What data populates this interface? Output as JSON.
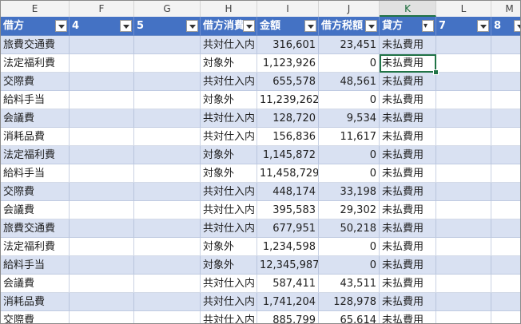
{
  "columns": [
    "E",
    "F",
    "G",
    "H",
    "I",
    "J",
    "K",
    "L",
    "M"
  ],
  "selected_column": "K",
  "table": {
    "headers": [
      "借方",
      "4",
      "5",
      "借方消費",
      "金額",
      "借方税額",
      "貸方",
      "7",
      "8"
    ],
    "rows": [
      [
        "旅費交通費",
        "",
        "",
        "共対仕入内",
        "316,601",
        "23,451",
        "未払費用",
        "",
        ""
      ],
      [
        "法定福利費",
        "",
        "",
        "対象外",
        "1,123,926",
        "0",
        "未払費用",
        "",
        ""
      ],
      [
        "交際費",
        "",
        "",
        "共対仕入内",
        "655,578",
        "48,561",
        "未払費用",
        "",
        ""
      ],
      [
        "給料手当",
        "",
        "",
        "対象外",
        "11,239,262",
        "0",
        "未払費用",
        "",
        ""
      ],
      [
        "会議費",
        "",
        "",
        "共対仕入内",
        "128,720",
        "9,534",
        "未払費用",
        "",
        ""
      ],
      [
        "消耗品費",
        "",
        "",
        "共対仕入内",
        "156,836",
        "11,617",
        "未払費用",
        "",
        ""
      ],
      [
        "法定福利費",
        "",
        "",
        "対象外",
        "1,145,872",
        "0",
        "未払費用",
        "",
        ""
      ],
      [
        "給料手当",
        "",
        "",
        "対象外",
        "11,458,729",
        "0",
        "未払費用",
        "",
        ""
      ],
      [
        "交際費",
        "",
        "",
        "共対仕入内",
        "448,174",
        "33,198",
        "未払費用",
        "",
        ""
      ],
      [
        "会議費",
        "",
        "",
        "共対仕入内",
        "395,583",
        "29,302",
        "未払費用",
        "",
        ""
      ],
      [
        "旅費交通費",
        "",
        "",
        "共対仕入内",
        "677,951",
        "50,218",
        "未払費用",
        "",
        ""
      ],
      [
        "法定福利費",
        "",
        "",
        "対象外",
        "1,234,598",
        "0",
        "未払費用",
        "",
        ""
      ],
      [
        "給料手当",
        "",
        "",
        "対象外",
        "12,345,987",
        "0",
        "未払費用",
        "",
        ""
      ],
      [
        "会議費",
        "",
        "",
        "共対仕入内",
        "587,411",
        "43,511",
        "未払費用",
        "",
        ""
      ],
      [
        "消耗品費",
        "",
        "",
        "共対仕入内",
        "1,741,204",
        "128,978",
        "未払費用",
        "",
        ""
      ],
      [
        "交際費",
        "",
        "",
        "共対仕入内",
        "885,799",
        "65,614",
        "未払費用",
        "",
        ""
      ]
    ]
  },
  "colors": {
    "header_bg": "#4472c4",
    "band_bg": "#d9e1f2",
    "selection": "#217346"
  }
}
